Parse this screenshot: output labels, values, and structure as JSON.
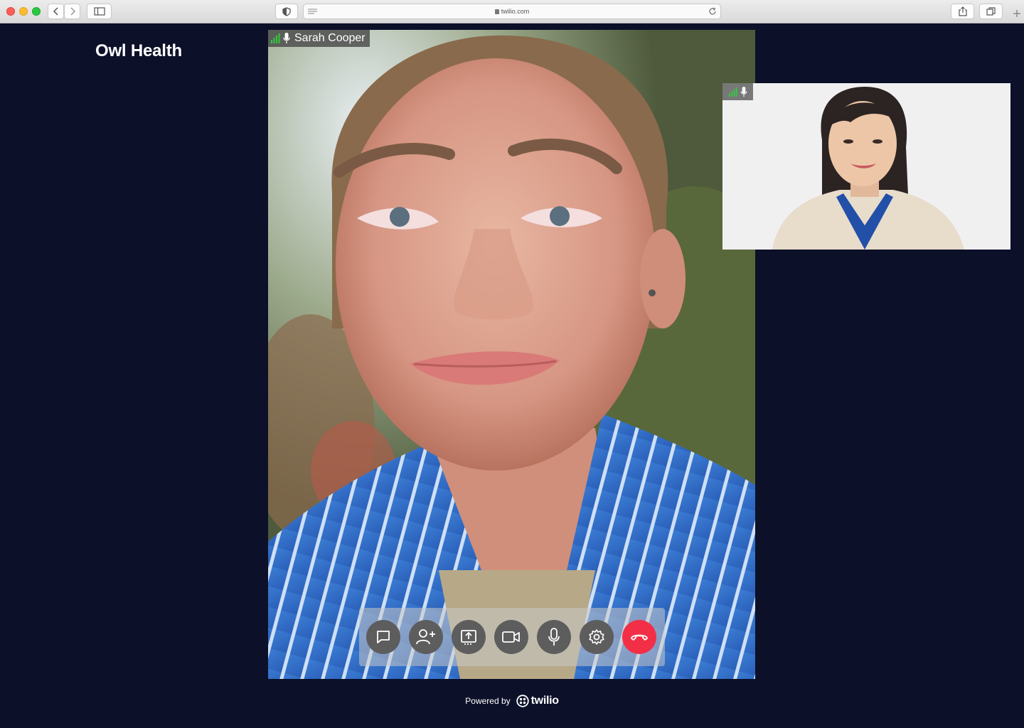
{
  "browser": {
    "url": "twilio.com"
  },
  "brand": {
    "name": "Owl Health"
  },
  "main_video": {
    "participant_name": "Sarah Cooper",
    "signal_level": 4,
    "mic_icon": "microphone-icon"
  },
  "self_view": {
    "signal_level": 4,
    "mic_icon": "microphone-icon"
  },
  "controls": {
    "buttons": [
      {
        "icon": "chat-icon"
      },
      {
        "icon": "add-participant-icon"
      },
      {
        "icon": "screen-share-icon"
      },
      {
        "icon": "camera-icon"
      },
      {
        "icon": "microphone-icon"
      },
      {
        "icon": "settings-gear-icon"
      },
      {
        "icon": "end-call-icon"
      }
    ],
    "end_call_color": "#f22f46"
  },
  "footer": {
    "powered_by": "Powered by",
    "brand": "twilio"
  },
  "colors": {
    "background": "#0c1029",
    "signal": "#2ecc40"
  }
}
